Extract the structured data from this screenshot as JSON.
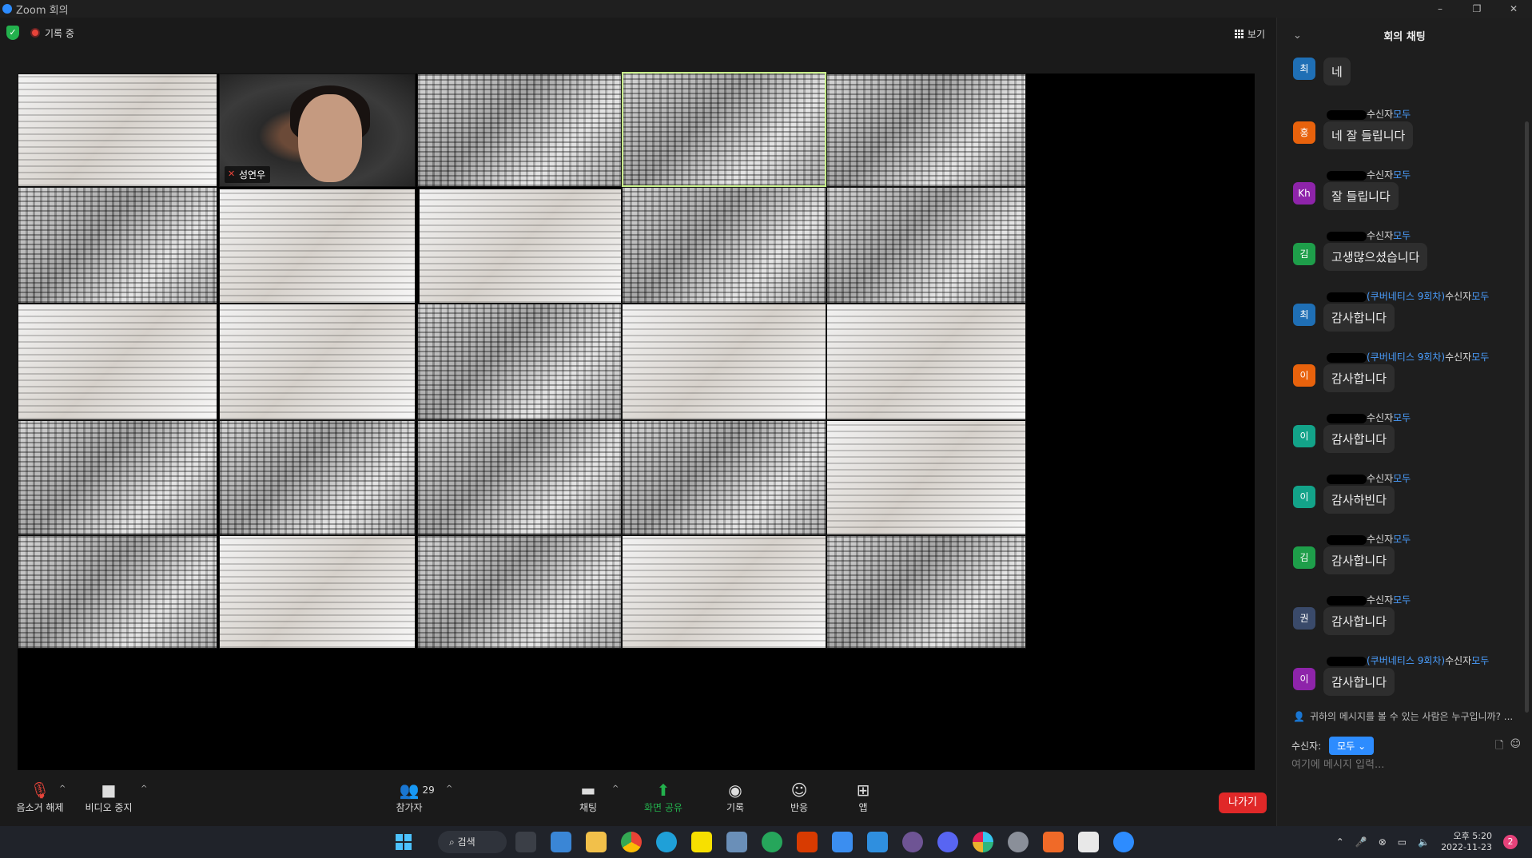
{
  "window": {
    "title": "Zoom 회의",
    "controls": [
      "–",
      "❐",
      "✕"
    ]
  },
  "status": {
    "recording_label": "기록 중",
    "view_label": "보기"
  },
  "tiles": [
    {
      "name": "",
      "style": "light"
    },
    {
      "name": "성연우",
      "style": "photo"
    },
    {
      "name": "",
      "style": "noise"
    },
    {
      "name": "",
      "style": "noise",
      "active": true
    },
    {
      "name": "",
      "style": "noise"
    }
  ],
  "toolbar": {
    "mute_label": "음소거 해제",
    "video_label": "비디오 중지",
    "participants_label": "참가자",
    "participants_count": "29",
    "chat_label": "채팅",
    "share_label": "화면 공유",
    "record_label": "기록",
    "reactions_label": "반응",
    "apps_label": "앱",
    "leave_label": "나가기"
  },
  "chat": {
    "title": "회의 채팅",
    "messages": [
      {
        "avatar": "최",
        "avatar_color": "#1f6fb5",
        "sender_tag": "",
        "to": "",
        "all": "",
        "text": "네"
      },
      {
        "avatar": "홍",
        "avatar_color": "#e8620c",
        "sender_tag": "",
        "to": "수신자",
        "all": "모두",
        "text": "네 잘 들립니다"
      },
      {
        "avatar": "Kh",
        "avatar_color": "#8e24aa",
        "sender_tag": "",
        "to": "수신자",
        "all": "모두",
        "text": "잘 들립니다"
      },
      {
        "avatar": "김",
        "avatar_color": "#1e9e4a",
        "sender_tag": "",
        "to": "수신자",
        "all": "모두",
        "text": "고생많으셨습니다"
      },
      {
        "avatar": "최",
        "avatar_color": "#1f6fb5",
        "sender_tag": "(쿠버네티스 9회차)",
        "to": "수신자",
        "all": "모두",
        "text": "감사합니다"
      },
      {
        "avatar": "이",
        "avatar_color": "#e8620c",
        "sender_tag": "(쿠버네티스 9회차)",
        "to": "수신자",
        "all": "모두",
        "text": "감사합니다"
      },
      {
        "avatar": "이",
        "avatar_color": "#13a389",
        "sender_tag": "",
        "to": "수신자",
        "all": "모두",
        "text": "감사합니다"
      },
      {
        "avatar": "이",
        "avatar_color": "#13a389",
        "sender_tag": "",
        "to": "수신자",
        "all": "모두",
        "text": "감사하빈다"
      },
      {
        "avatar": "김",
        "avatar_color": "#1e9e4a",
        "sender_tag": "",
        "to": "수신자",
        "all": "모두",
        "text": "감사합니다"
      },
      {
        "avatar": "권",
        "avatar_color": "#3a4a6a",
        "sender_tag": "",
        "to": "수신자",
        "all": "모두",
        "text": "감사합니다"
      },
      {
        "avatar": "이",
        "avatar_color": "#8e24aa",
        "sender_tag": "(쿠버네티스 9회차)",
        "to": "수신자",
        "all": "모두",
        "text": "감사합니다"
      }
    ],
    "who_can_see": "귀하의 메시지를 볼 수 있는 사람은 누구입니까? ...",
    "recipient_label": "수신자:",
    "recipient_value": "모두",
    "input_placeholder": "여기에 메시지 입력..."
  },
  "taskbar": {
    "search_label": "검색",
    "time": "오후 5:20",
    "date": "2022-11-23",
    "notification_count": "2"
  }
}
